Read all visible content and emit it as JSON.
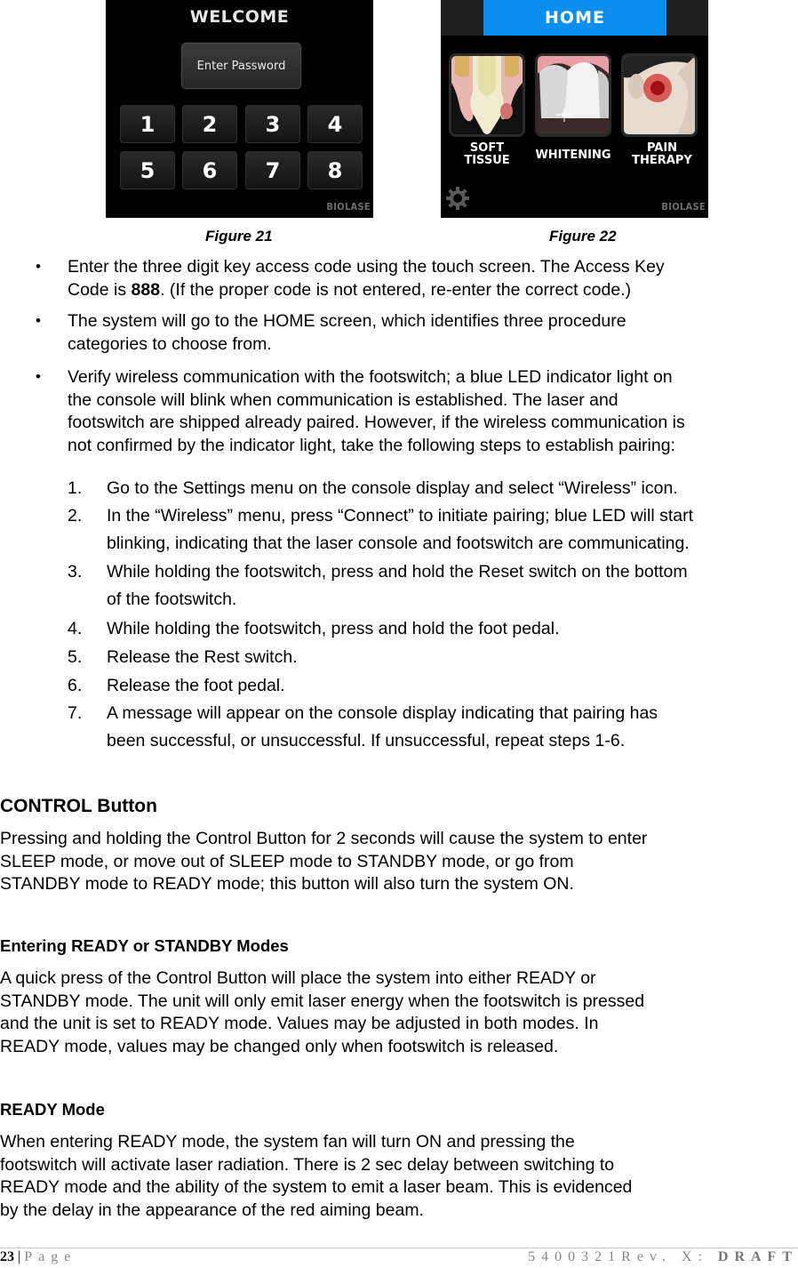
{
  "figures": {
    "fig21": {
      "title": "WELCOME",
      "password_button": "Enter Password",
      "keys": [
        "1",
        "2",
        "3",
        "4",
        "5",
        "6",
        "7",
        "8"
      ],
      "brand": "BIOLASE",
      "caption": "Figure 21"
    },
    "fig22": {
      "title": "HOME",
      "title_bar_color": "#0a8ff0",
      "tiles": [
        {
          "label_line1": "SOFT",
          "label_line2": "TISSUE",
          "icon": "tooth-soft-tissue-image"
        },
        {
          "label_line1": "WHITENING",
          "label_line2": "",
          "icon": "teeth-whitening-image"
        },
        {
          "label_line1": "PAIN",
          "label_line2": "THERAPY",
          "icon": "face-pain-therapy-image"
        }
      ],
      "settings_icon": "gear-icon",
      "brand": "BIOLASE",
      "caption": "Figure 22"
    }
  },
  "bullets": [
    {
      "lines": [
        "Enter the three digit key access code using the touch screen.  The Access Key",
        "Code is "
      ],
      "bold": "888",
      "after_bold": ". (If the proper code is not entered, re-enter the correct code.)"
    },
    {
      "lines": [
        "The system will go to the HOME screen, which identifies three procedure",
        "categories to choose from."
      ]
    },
    {
      "lines": [
        "Verify wireless communication with the footswitch; a blue LED indicator light on",
        "the console will blink when communication is established.  The laser and",
        "footswitch are shipped already paired.  However, if the wireless communication is",
        "not confirmed by the indicator light, take the following steps to establish pairing:"
      ]
    }
  ],
  "steps": [
    {
      "num": "1.",
      "lines": [
        "Go to the Settings menu on the console display and select “Wireless” icon."
      ]
    },
    {
      "num": "2.",
      "lines": [
        "In the “Wireless” menu, press “Connect” to initiate pairing; blue LED will start",
        "blinking, indicating that the laser console and footswitch are communicating."
      ]
    },
    {
      "num": "3.",
      "lines": [
        "While holding the footswitch, press and hold the Reset switch on the bottom",
        "of the footswitch."
      ]
    },
    {
      "num": "4.",
      "lines": [
        "While holding the footswitch, press and hold the foot pedal."
      ]
    },
    {
      "num": "5.",
      "lines": [
        "Release the Rest switch."
      ]
    },
    {
      "num": "6.",
      "lines": [
        "Release the foot pedal."
      ]
    },
    {
      "num": "7.",
      "lines": [
        "A message will appear on the console display indicating that pairing has",
        "been successful, or unsuccessful.  If unsuccessful, repeat steps 1-6."
      ]
    }
  ],
  "sections": [
    {
      "heading": "CONTROL Button",
      "lines": [
        "Pressing and holding the Control Button for 2 seconds will cause the system to enter",
        "SLEEP mode, or move out of SLEEP mode to STANDBY mode, or go from",
        "STANDBY mode to READY mode; this button will also turn the system ON."
      ]
    },
    {
      "heading": "Entering READY or STANDBY Modes",
      "lines": [
        "A quick press of the Control Button will place the system into either READY or",
        "STANDBY mode. The unit will only emit laser energy when the footswitch is pressed",
        "and the unit is set to READY mode. Values may be adjusted in both modes. In",
        "READY mode, values may be changed only when footswitch is released."
      ]
    },
    {
      "heading": "READY Mode",
      "lines": [
        "When entering READY mode, the system fan will turn ON and pressing the",
        "footswitch will activate laser radiation. There is 2 sec delay between switching to",
        "READY mode and the ability of the system to emit a laser beam.  This is evidenced",
        "by the delay in the appearance of the red aiming beam."
      ]
    }
  ],
  "footer": {
    "page_number": "23",
    "separator": "|",
    "page_word": "Page",
    "doc_id": "5400321Rev. X: ",
    "draft": "DRAFT"
  }
}
